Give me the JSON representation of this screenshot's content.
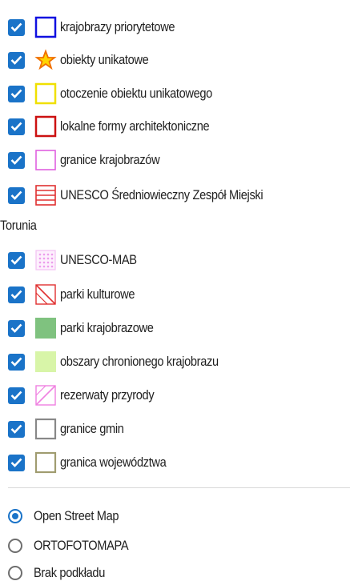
{
  "layers": [
    {
      "label": "krajobrazy priorytetowe",
      "icon": "blue-square-outline-icon",
      "color": "#1010e0",
      "checked": true
    },
    {
      "label": "obiekty unikatowe",
      "icon": "orange-star-icon",
      "color": "#f5a000",
      "checked": true
    },
    {
      "label": "otoczenie obiektu unikatowego",
      "icon": "yellow-square-outline-icon",
      "color": "#f0e000",
      "checked": true
    },
    {
      "label": "lokalne formy architektoniczne",
      "icon": "red-square-outline-icon",
      "color": "#cc1111",
      "checked": true
    },
    {
      "label": "granice krajobrazów",
      "icon": "pink-square-outline-icon",
      "color": "#e060e0",
      "checked": true
    },
    {
      "label": "UNESCO Średniowieczny Zespół Miejski",
      "label_wrap": "Torunia",
      "icon": "red-striped-square-icon",
      "color": "#e03030",
      "checked": true
    },
    {
      "label": "UNESCO-MAB",
      "icon": "pink-dotted-square-icon",
      "color": "#f2c0f2",
      "checked": true
    },
    {
      "label": "parki kulturowe",
      "icon": "red-diagonal-hatch-icon",
      "color": "#e03030",
      "checked": true
    },
    {
      "label": "parki krajobrazowe",
      "icon": "green-filled-square-icon",
      "color": "#7fc27f",
      "checked": true
    },
    {
      "label": "obszary chronionego krajobrazu",
      "icon": "lightgreen-filled-square-icon",
      "color": "#d8f5a8",
      "checked": true
    },
    {
      "label": "rezerwaty przyrody",
      "icon": "pink-diagonal-hatch-icon",
      "color": "#f080e0",
      "checked": true
    },
    {
      "label": "granice gmin",
      "icon": "gray-square-outline-icon",
      "color": "#888888",
      "checked": true
    },
    {
      "label": "granica województwa",
      "icon": "olive-square-outline-icon",
      "color": "#a09c70",
      "checked": true
    }
  ],
  "basemaps": [
    {
      "label": "Open Street Map",
      "selected": true
    },
    {
      "label": "ORTOFOTOMAPA",
      "selected": false
    },
    {
      "label": "Brak podkładu",
      "selected": false
    }
  ]
}
